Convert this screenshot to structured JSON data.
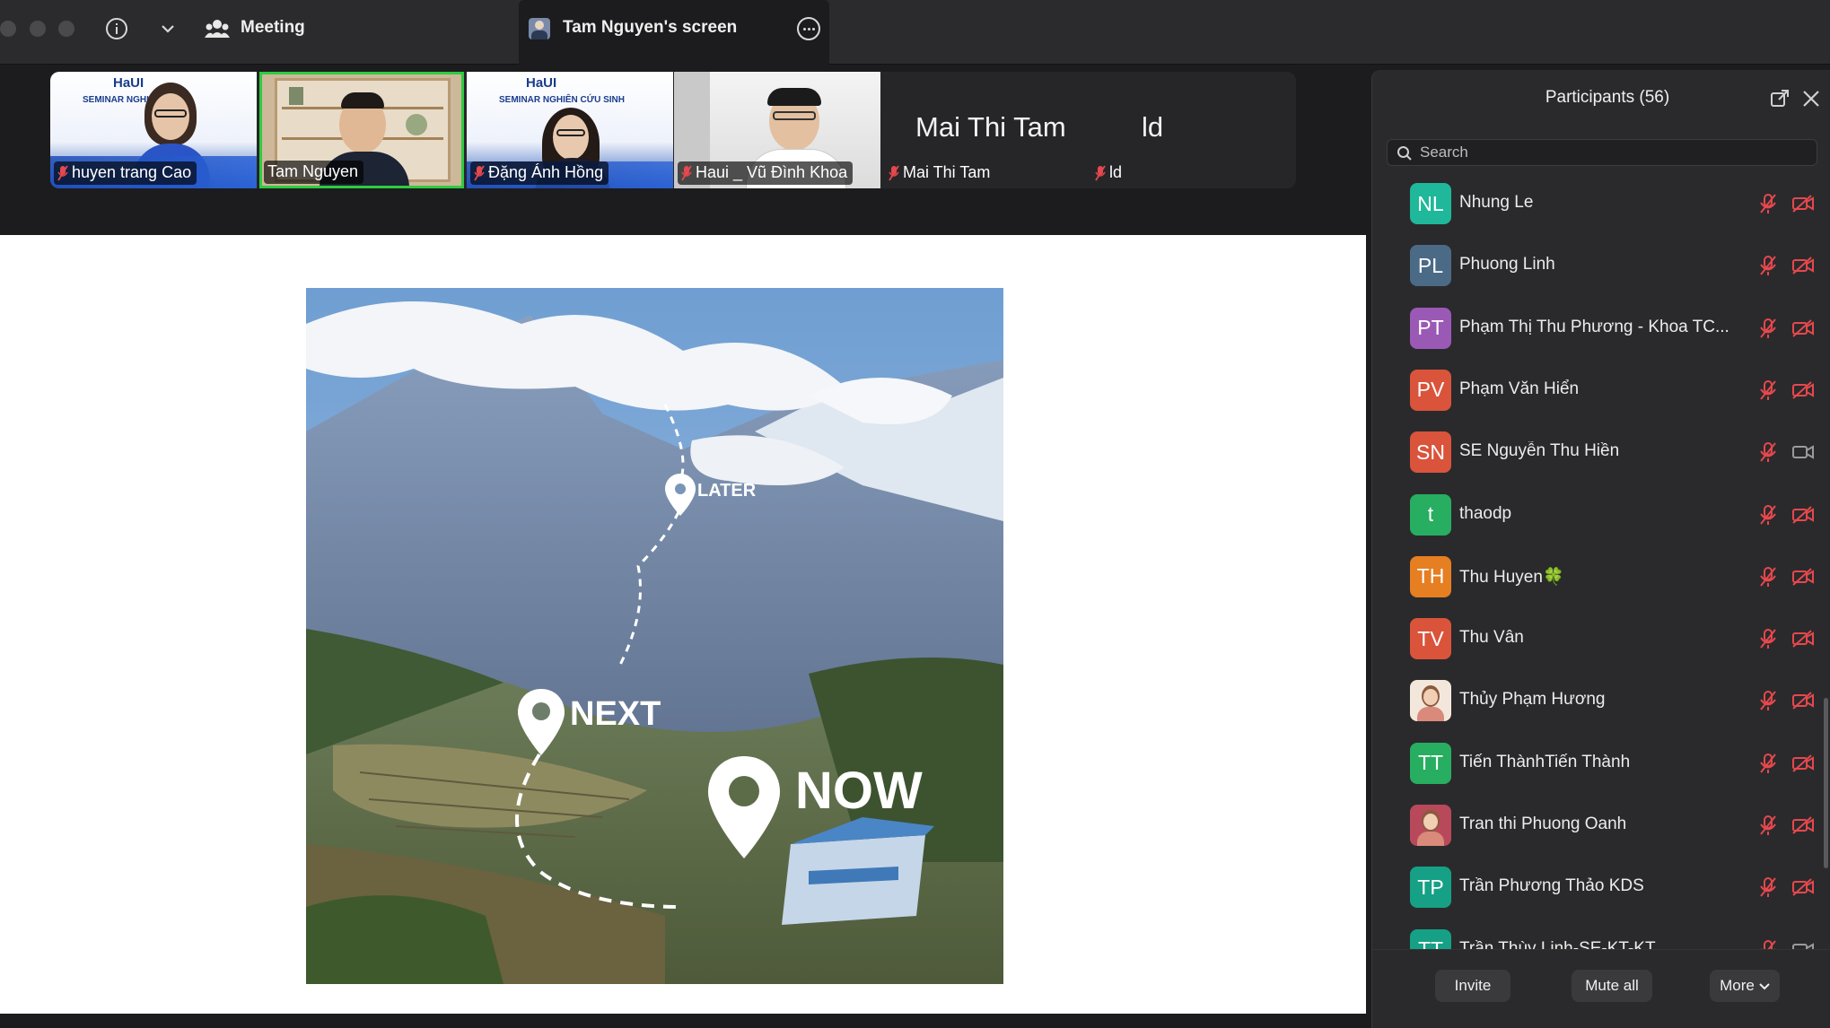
{
  "topbar": {
    "meeting_label": "Meeting",
    "share_tab_label": "Tam Nguyen's screen"
  },
  "video_strip": [
    {
      "name": "huyen trang Cao",
      "type": "video",
      "banner_logo": "HaUI",
      "banner_title": "SEMINAR NGHI…",
      "muted": true
    },
    {
      "name": "Tam Nguyen",
      "type": "video",
      "active_speaker": true,
      "muted": false
    },
    {
      "name": "Đặng Ánh Hồng",
      "type": "video",
      "banner_logo": "HaUI",
      "banner_title": "SEMINAR NGHIÊN CỨU SINH",
      "muted": true
    },
    {
      "name": "Haui _ Vũ Đình Khoa",
      "type": "video",
      "muted": true
    },
    {
      "name": "Mai Thi Tam",
      "type": "name-only",
      "display": "Mai Thi Tam",
      "muted": true
    },
    {
      "name": "ld",
      "type": "name-only",
      "display": "ld",
      "muted": true
    }
  ],
  "slide": {
    "labels": {
      "later": "LATER",
      "next": "NEXT",
      "now": "NOW"
    }
  },
  "participants": {
    "title": "Participants (56)",
    "search_placeholder": "Search",
    "list": [
      {
        "initials": "NL",
        "name": "Nhung Le",
        "color": "#1fb89a",
        "video_off": true
      },
      {
        "initials": "PL",
        "name": "Phuong Linh",
        "color": "#4b6a86",
        "video_off": true
      },
      {
        "initials": "PT",
        "name": "Phạm Thị Thu Phương - Khoa TC...",
        "color": "#9b59b6",
        "video_off": true
      },
      {
        "initials": "PV",
        "name": "Phạm Văn Hiển",
        "color": "#d9543b",
        "video_off": true
      },
      {
        "initials": "SN",
        "name": "SE Nguyễn Thu Hiền",
        "color": "#d9543b",
        "video_off": false
      },
      {
        "initials": "t",
        "name": "thaodp",
        "color": "#27ae60",
        "video_off": true
      },
      {
        "initials": "TH",
        "name": "Thu Huyen🍀",
        "color": "#e67e22",
        "video_off": true
      },
      {
        "initials": "TV",
        "name": "Thu Vân",
        "color": "#d9543b",
        "video_off": true
      },
      {
        "initials": "",
        "name": "Thủy Phạm Hương",
        "color": "#f3e7dc",
        "photo": true,
        "video_off": true
      },
      {
        "initials": "TT",
        "name": "Tiến ThànhTiến Thành",
        "color": "#27ae60",
        "video_off": true
      },
      {
        "initials": "",
        "name": "Tran thi Phuong Oanh",
        "color": "#b8495a",
        "photo": true,
        "video_off": true
      },
      {
        "initials": "TP",
        "name": "Trần Phương Thảo KDS",
        "color": "#16a085",
        "video_off": true
      },
      {
        "initials": "TT",
        "name": "Trần Thùy Linh-SE-KT-KT",
        "color": "#16a085",
        "video_off": false
      }
    ],
    "buttons": {
      "invite": "Invite",
      "mute_all": "Mute all",
      "more": "More"
    }
  },
  "colors": {
    "muted_red": "#e5484d",
    "active_speaker": "#2ecc40",
    "panel_bg": "#2a2a2c"
  }
}
